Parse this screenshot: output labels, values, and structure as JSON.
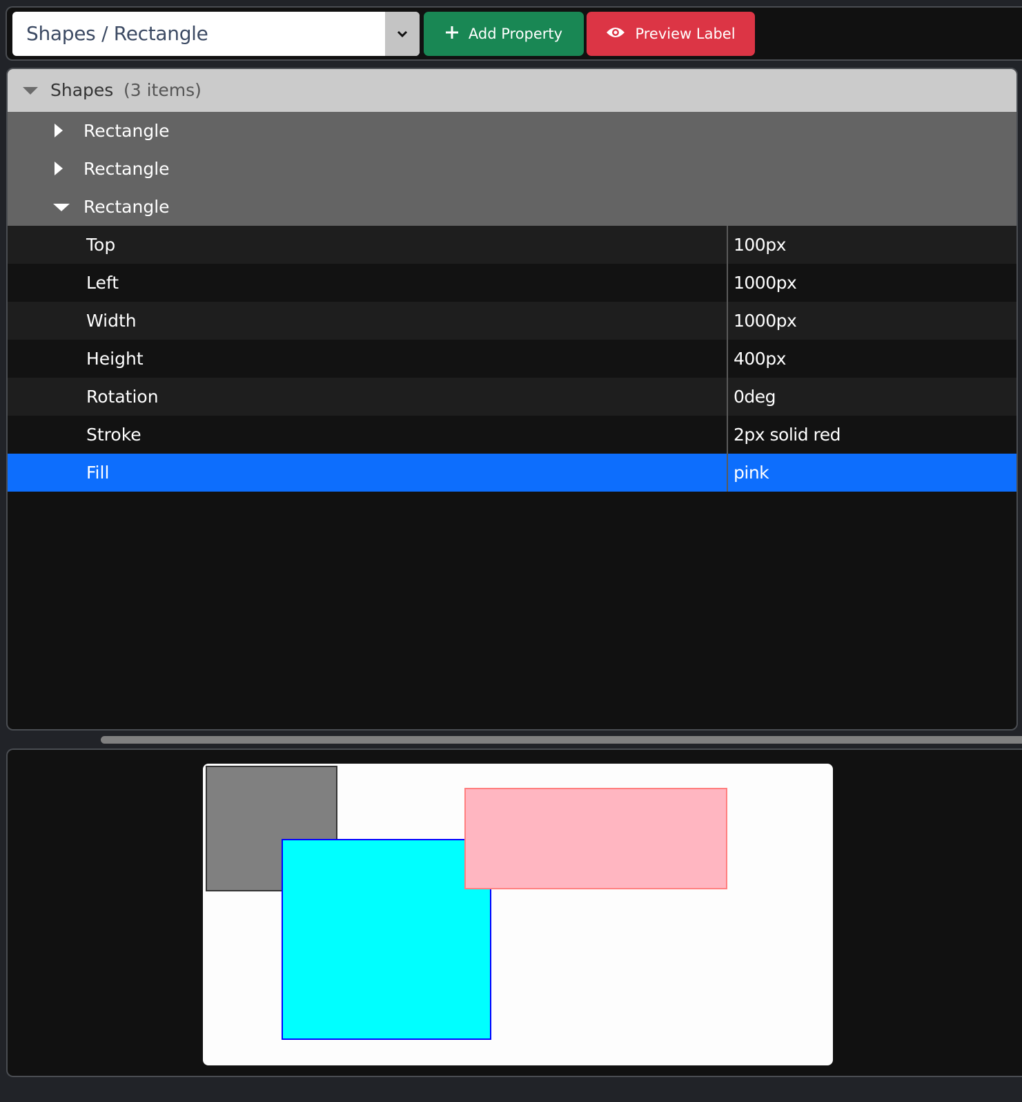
{
  "toolbar": {
    "select": {
      "value": "Shapes / Rectangle",
      "caret_icon": "chevron-down-icon"
    },
    "add_property": {
      "label": "Add Property",
      "icon": "plus-icon",
      "color": "#198754"
    },
    "preview_label": {
      "label": "Preview Label",
      "icon": "eye-icon",
      "color": "#dc3545"
    }
  },
  "tree": {
    "root": {
      "label": "Shapes",
      "count": "(3 items)",
      "expanded": true
    },
    "children": [
      {
        "label": "Rectangle",
        "expanded": false
      },
      {
        "label": "Rectangle",
        "expanded": false
      },
      {
        "label": "Rectangle",
        "expanded": true
      }
    ],
    "properties": [
      {
        "key": "Top",
        "value": "100px",
        "selected": false
      },
      {
        "key": "Left",
        "value": "1000px",
        "selected": false
      },
      {
        "key": "Width",
        "value": "1000px",
        "selected": false
      },
      {
        "key": "Height",
        "value": "400px",
        "selected": false
      },
      {
        "key": "Rotation",
        "value": "0deg",
        "selected": false
      },
      {
        "key": "Stroke",
        "value": "2px solid red",
        "selected": false
      },
      {
        "key": "Fill",
        "value": "pink",
        "selected": true
      }
    ],
    "selection_color": "#0d6efd"
  },
  "preview": {
    "background": "#ffffff",
    "shapes": [
      {
        "name": "gray-rectangle",
        "fill": "#808080",
        "stroke": "#333333"
      },
      {
        "name": "cyan-rectangle",
        "fill": "#00ffff",
        "stroke": "#0000ff"
      },
      {
        "name": "pink-rectangle",
        "fill": "#ffb6c1",
        "stroke": "#ff7f7f"
      }
    ]
  }
}
